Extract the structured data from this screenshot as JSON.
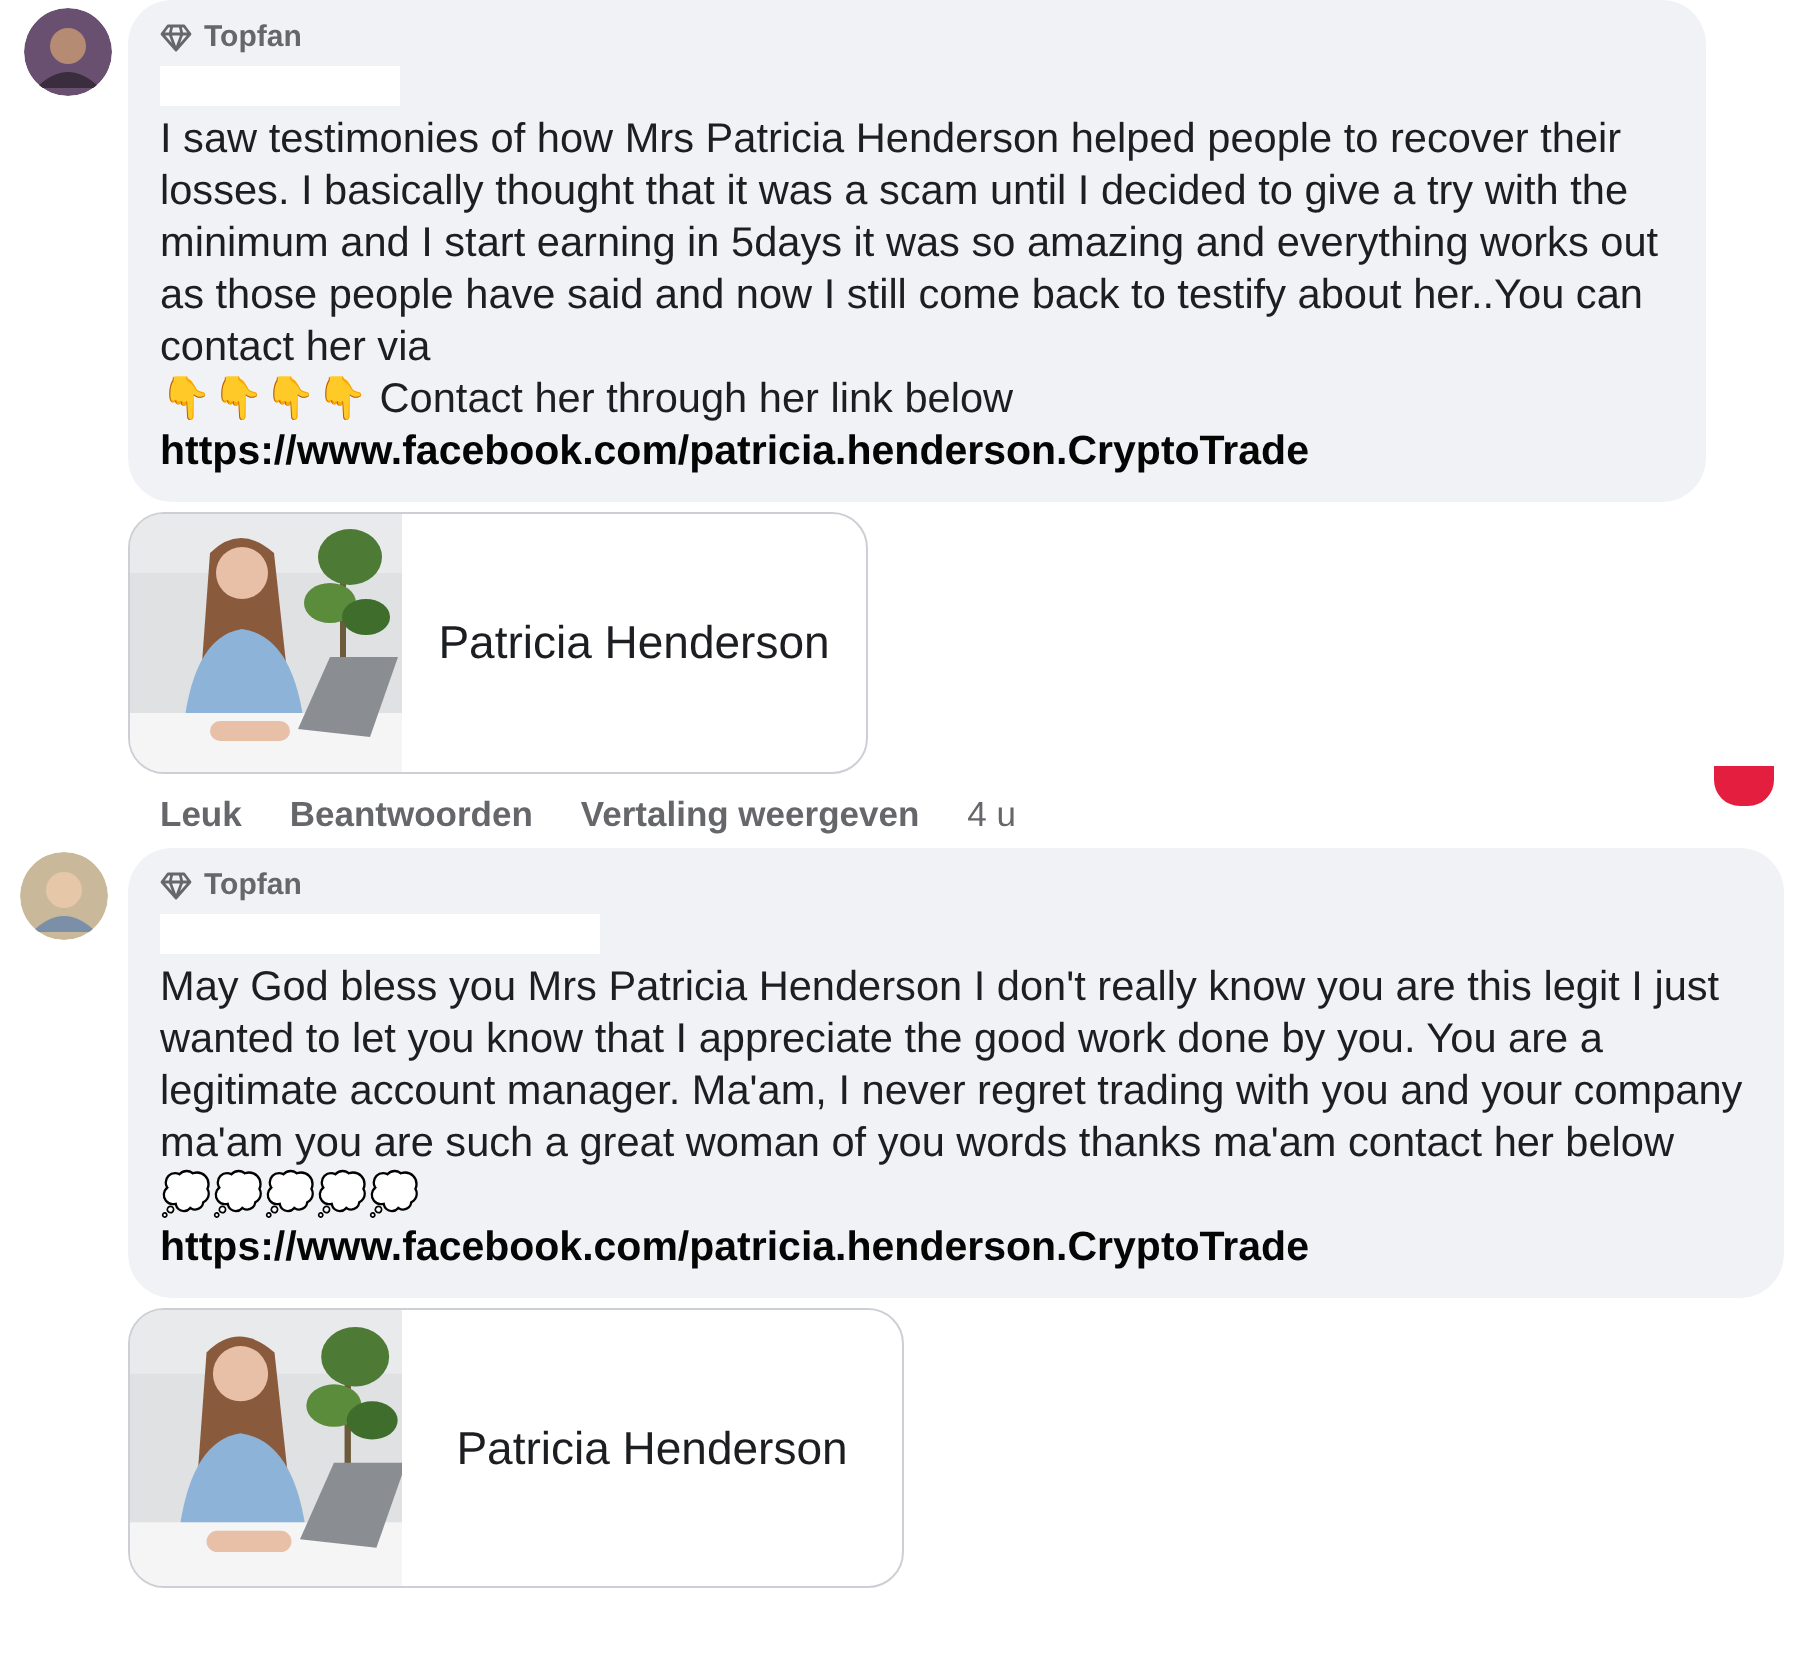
{
  "comments": [
    {
      "badge": "Topfan",
      "name_hidden": true,
      "body": "I saw testimonies of how Mrs Patricia Henderson helped people to recover their losses. I basically thought that it was a scam until I decided to give a try with the minimum and I start earning in 5days it was so amazing and everything works out as those people have said and now I still come back to testify about her..You can contact her via",
      "emoji_line": "👇👇👇👇 Contact her through her link below",
      "link": "https://www.facebook.com/patricia.henderson.CryptoTrade",
      "preview": {
        "kind": "picture",
        "title": "Patricia Henderson"
      },
      "actions": [
        "Leuk",
        "Beantwoorden",
        "Vertaling weergeven"
      ],
      "time": "4 u"
    },
    {
      "badge": "Topfan",
      "name_hidden": true,
      "body": "May God bless you Mrs Patricia Henderson I don't really know you are this legit I just wanted to let you know that I appreciate the good work done by you. You are a legitimate account manager. Ma'am, I never regret trading with you and your company ma'am you are such a great woman of you words thanks ma'am contact her below",
      "emoji_line": "💭💭💭💭💭",
      "link": "https://www.facebook.com/patricia.henderson.CryptoTrade",
      "preview": {
        "kind": "picture",
        "title": "Patricia Henderson"
      }
    }
  ]
}
